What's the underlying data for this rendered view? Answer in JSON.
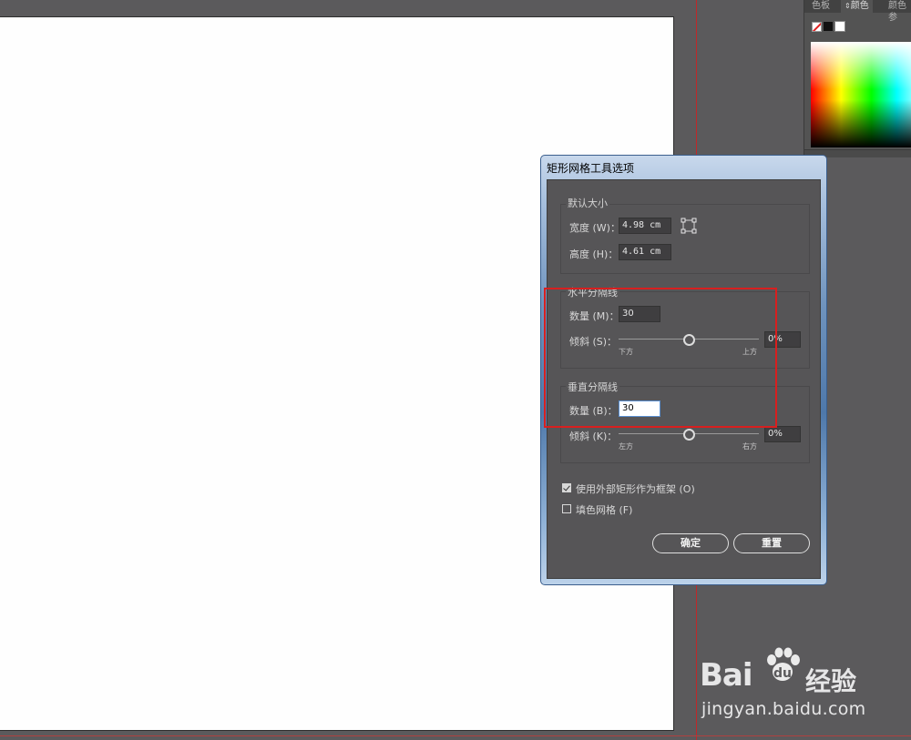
{
  "color_panel": {
    "tabs": [
      "色板",
      "颜色",
      "颜色参"
    ],
    "active_tab": "颜色",
    "swatches": [
      "none-swatch",
      "black-swatch",
      "white-swatch"
    ]
  },
  "dialog": {
    "title": "矩形网格工具选项",
    "default_size": {
      "legend": "默认大小",
      "width_label": "宽度 (W)：",
      "width_value": "4.98 cm",
      "height_label": "高度 (H)：",
      "height_value": "4.61 cm"
    },
    "horizontal_dividers": {
      "legend": "水平分隔线",
      "count_label": "数量 (M)：",
      "count_value": "30",
      "skew_label": "倾斜 (S)：",
      "skew_value": "0%",
      "skew_level": 0,
      "tick_left": "下方",
      "tick_right": "上方"
    },
    "vertical_dividers": {
      "legend": "垂直分隔线",
      "count_label": "数量 (B)：",
      "count_value": "30",
      "skew_label": "倾斜 (K)：",
      "skew_value": "0%",
      "skew_level": 0,
      "tick_left": "左方",
      "tick_right": "右方"
    },
    "use_outside_rect": {
      "label": "使用外部矩形作为框架 (O)",
      "checked": true
    },
    "fill_grid": {
      "label": "填色网格 (F)",
      "checked": false
    },
    "ok_label": "确定",
    "reset_label": "重置"
  },
  "watermark": {
    "brand_left": "Bai",
    "brand_right": "经验",
    "url": "jingyan.baidu.com"
  },
  "colors": {
    "workspace": "#5b5a5c",
    "highlight": "#d81f1f",
    "bleed": "#c0282a"
  }
}
